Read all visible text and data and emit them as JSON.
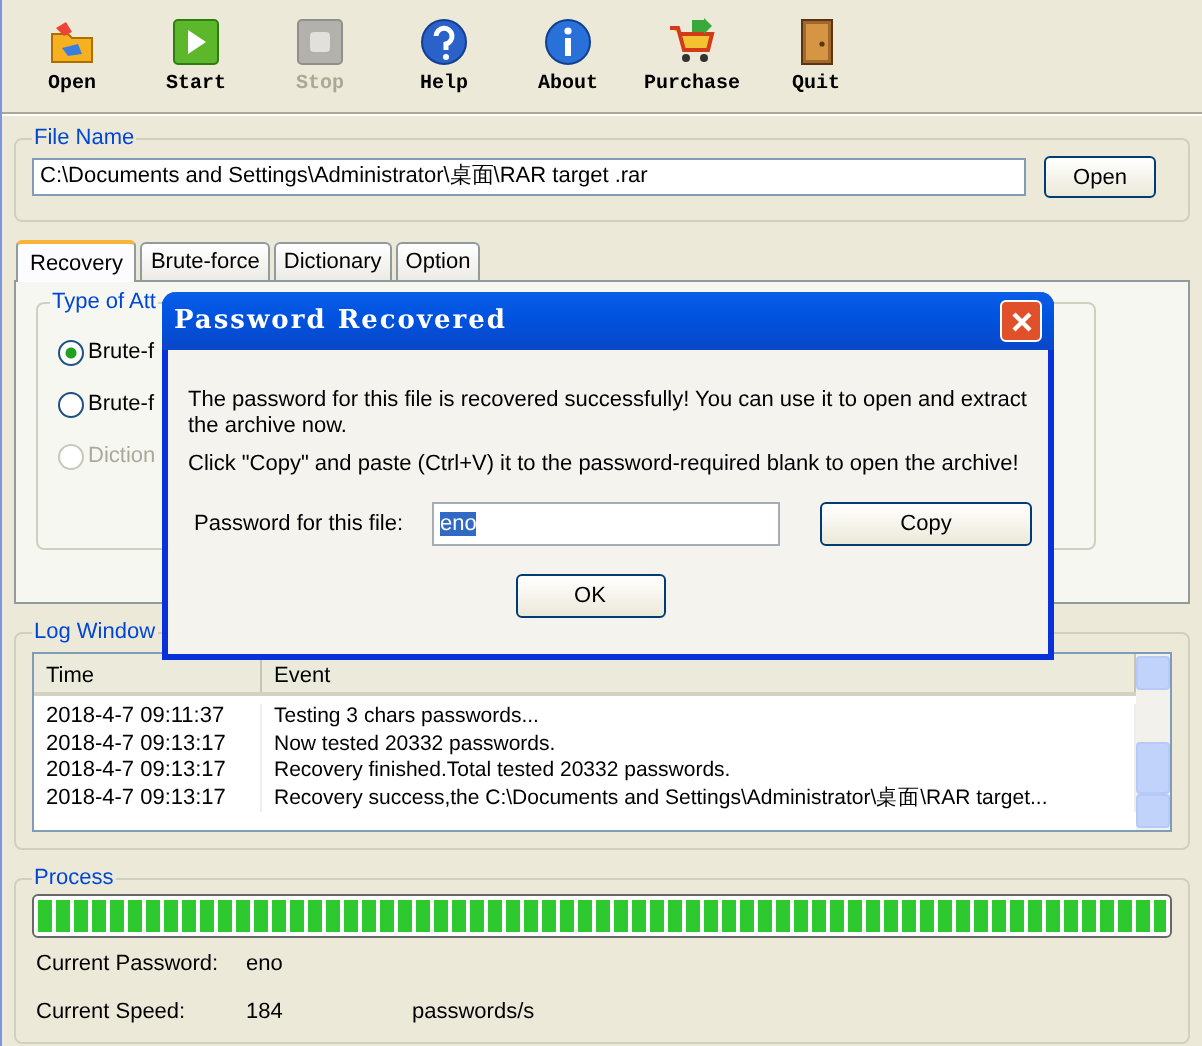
{
  "toolbar": [
    {
      "label": "Open",
      "kind": "folder",
      "disabled": false
    },
    {
      "label": "Start",
      "kind": "play",
      "disabled": false
    },
    {
      "label": "Stop",
      "kind": "stop",
      "disabled": true
    },
    {
      "label": "Help",
      "kind": "question",
      "disabled": false
    },
    {
      "label": "About",
      "kind": "info",
      "disabled": false
    },
    {
      "label": "Purchase",
      "kind": "cart",
      "disabled": false
    },
    {
      "label": "Quit",
      "kind": "door",
      "disabled": false
    }
  ],
  "file_name": {
    "legend": "File Name",
    "value": "C:\\Documents and Settings\\Administrator\\桌面\\RAR target .rar",
    "button": "Open"
  },
  "tabs": [
    {
      "label": "Recovery",
      "selected": true
    },
    {
      "label": "Brute-force",
      "selected": false
    },
    {
      "label": "Dictionary",
      "selected": false
    },
    {
      "label": "Option",
      "selected": false
    }
  ],
  "attack_type": {
    "legend": "Type of Att",
    "options": [
      {
        "label": "Brute-f",
        "checked": true,
        "disabled": false
      },
      {
        "label": "Brute-f",
        "checked": false,
        "disabled": false
      },
      {
        "label": "Diction",
        "checked": false,
        "disabled": true
      }
    ]
  },
  "log_window": {
    "legend": "Log Window",
    "columns": [
      "Time",
      "Event"
    ],
    "rows": [
      {
        "time": "2018-4-7 09:11:37",
        "event": "Testing  3 chars passwords..."
      },
      {
        "time": "2018-4-7 09:13:17",
        "event": "Now tested  20332 passwords."
      },
      {
        "time": "2018-4-7 09:13:17",
        "event": "Recovery finished.Total tested  20332 passwords."
      },
      {
        "time": "2018-4-7 09:13:17",
        "event": "Recovery success,the C:\\Documents and Settings\\Administrator\\桌面\\RAR target..."
      }
    ]
  },
  "process": {
    "legend": "Process",
    "level": 1,
    "fields": [
      {
        "label": "Current Password:",
        "value": "eno"
      },
      {
        "label": "Current Speed:",
        "value": "184",
        "unit": "passwords/s"
      }
    ]
  },
  "dialog": {
    "title": "Password Recovered",
    "messages": [
      "The password for this file is recovered successfully! You can use it to open and extract the archive now.",
      "Click \"Copy\" and paste (Ctrl+V) it to the password-required blank to open the archive!"
    ],
    "password_label": "Password for this file:",
    "password": "eno",
    "password_highlighted": true,
    "copy_button": "Copy",
    "ok_button": "OK"
  }
}
